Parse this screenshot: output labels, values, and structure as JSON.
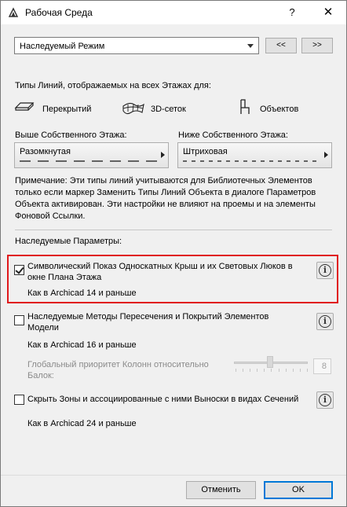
{
  "window": {
    "title": "Рабочая Среда",
    "help_label": "?",
    "close_label": "✕"
  },
  "mode_select": {
    "value": "Наследуемый Режим",
    "prev_label": "<<",
    "next_label": ">>"
  },
  "line_types": {
    "heading": "Типы Линий, отображаемых на всех Этажах для:",
    "options": [
      "Перекрытий",
      "3D-сеток",
      "Объектов"
    ],
    "above_label": "Выше Собственного Этажа:",
    "above_value": "Разомкнутая",
    "below_label": "Ниже Собственного Этажа:",
    "below_value": "Штриховая"
  },
  "note": {
    "lines": [
      "Примечание: Эти типы линий учитываются для Библиотечных Элементов",
      "только если маркер Заменить Типы Линий Объекта в диалоге Параметров",
      "Объекта активирован. Эти настройки не влияют на проемы и на элементы",
      "Фоновой Ссылки."
    ]
  },
  "legacy": {
    "heading": "Наследуемые Параметры:",
    "items": [
      {
        "lines": [
          "Символический Показ Односкатных Крыш и их Световых Люков в",
          "окне Плана Этажа"
        ],
        "checked": true,
        "note": "Как в Archicad 14 и раньше"
      },
      {
        "lines": [
          "Наследуемые Методы Пересечения и Покрытий Элементов",
          "Модели"
        ],
        "checked": false,
        "note": "Как в Archicad 16 и раньше",
        "sub_lines": [
          "Глобальный приоритет Колонн относительно",
          "Балок:"
        ],
        "sub_value": "8"
      },
      {
        "lines": [
          "Скрыть Зоны и ассоциированные с ними Выноски в видах Сечений"
        ],
        "checked": false,
        "note": "Как в Archicad 24 и раньше"
      }
    ]
  },
  "buttons": {
    "cancel": "Отменить",
    "ok": "OK"
  },
  "colors": {
    "highlight": "#e0181b",
    "ok_border": "#0078d7"
  }
}
